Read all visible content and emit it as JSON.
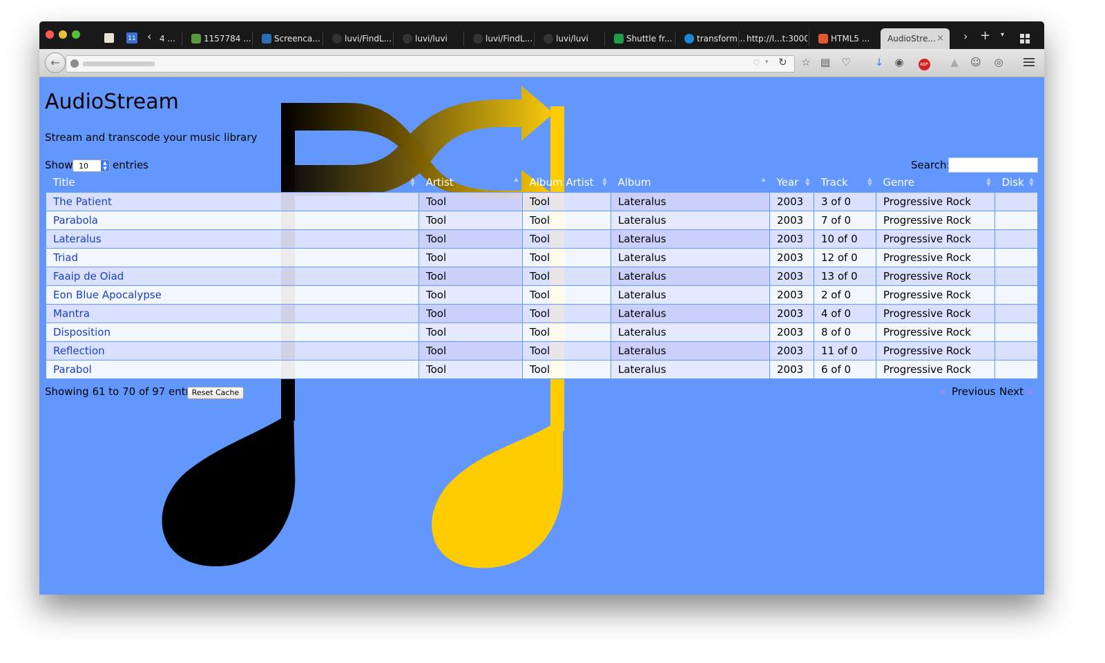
{
  "browser": {
    "tabs": [
      {
        "label": "4 ..."
      },
      {
        "label": "1157784 ..."
      },
      {
        "label": "Screenca..."
      },
      {
        "label": "luvi/FindL..."
      },
      {
        "label": "luvi/luvi"
      },
      {
        "label": "luvi/FindL..."
      },
      {
        "label": "luvi/luvi"
      },
      {
        "label": "Shuttle fr..."
      },
      {
        "label": "transform..."
      },
      {
        "label": "http://l...t:3000/"
      },
      {
        "label": "HTML5 ..."
      },
      {
        "label": "AudioStre..."
      }
    ]
  },
  "app": {
    "title": "AudioStream",
    "subtitle": "Stream and transcode your music library"
  },
  "controls": {
    "show_label": "Show",
    "length_value": "10",
    "entries_label": "entries",
    "search_label": "Search:",
    "search_value": ""
  },
  "table": {
    "columns": [
      "Title",
      "Artist",
      "Album Artist",
      "Album",
      "Year",
      "Track",
      "Genre",
      "Disk"
    ],
    "rows": [
      {
        "title": "The Patient",
        "artist": "Tool",
        "album_artist": "Tool",
        "album": "Lateralus",
        "year": "2003",
        "track": "3 of 0",
        "genre": "Progressive Rock",
        "disk": ""
      },
      {
        "title": "Parabola",
        "artist": "Tool",
        "album_artist": "Tool",
        "album": "Lateralus",
        "year": "2003",
        "track": "7 of 0",
        "genre": "Progressive Rock",
        "disk": ""
      },
      {
        "title": "Lateralus",
        "artist": "Tool",
        "album_artist": "Tool",
        "album": "Lateralus",
        "year": "2003",
        "track": "10 of 0",
        "genre": "Progressive Rock",
        "disk": ""
      },
      {
        "title": "Triad",
        "artist": "Tool",
        "album_artist": "Tool",
        "album": "Lateralus",
        "year": "2003",
        "track": "12 of 0",
        "genre": "Progressive Rock",
        "disk": ""
      },
      {
        "title": "Faaip de Oiad",
        "artist": "Tool",
        "album_artist": "Tool",
        "album": "Lateralus",
        "year": "2003",
        "track": "13 of 0",
        "genre": "Progressive Rock",
        "disk": ""
      },
      {
        "title": "Eon Blue Apocalypse",
        "artist": "Tool",
        "album_artist": "Tool",
        "album": "Lateralus",
        "year": "2003",
        "track": "2 of 0",
        "genre": "Progressive Rock",
        "disk": ""
      },
      {
        "title": "Mantra",
        "artist": "Tool",
        "album_artist": "Tool",
        "album": "Lateralus",
        "year": "2003",
        "track": "4 of 0",
        "genre": "Progressive Rock",
        "disk": ""
      },
      {
        "title": "Disposition",
        "artist": "Tool",
        "album_artist": "Tool",
        "album": "Lateralus",
        "year": "2003",
        "track": "8 of 0",
        "genre": "Progressive Rock",
        "disk": ""
      },
      {
        "title": "Reflection",
        "artist": "Tool",
        "album_artist": "Tool",
        "album": "Lateralus",
        "year": "2003",
        "track": "11 of 0",
        "genre": "Progressive Rock",
        "disk": ""
      },
      {
        "title": "Parabol",
        "artist": "Tool",
        "album_artist": "Tool",
        "album": "Lateralus",
        "year": "2003",
        "track": "6 of 0",
        "genre": "Progressive Rock",
        "disk": ""
      }
    ]
  },
  "footer": {
    "info": "Showing 61 to 70 of 97 entries",
    "reset_label": "Reset Cache",
    "previous_label": "Previous",
    "next_label": "Next"
  },
  "colors": {
    "page_bg": "#6297fe",
    "link": "#1a40c8",
    "logo_gold": "#ffcc00",
    "logo_black": "#000000"
  }
}
